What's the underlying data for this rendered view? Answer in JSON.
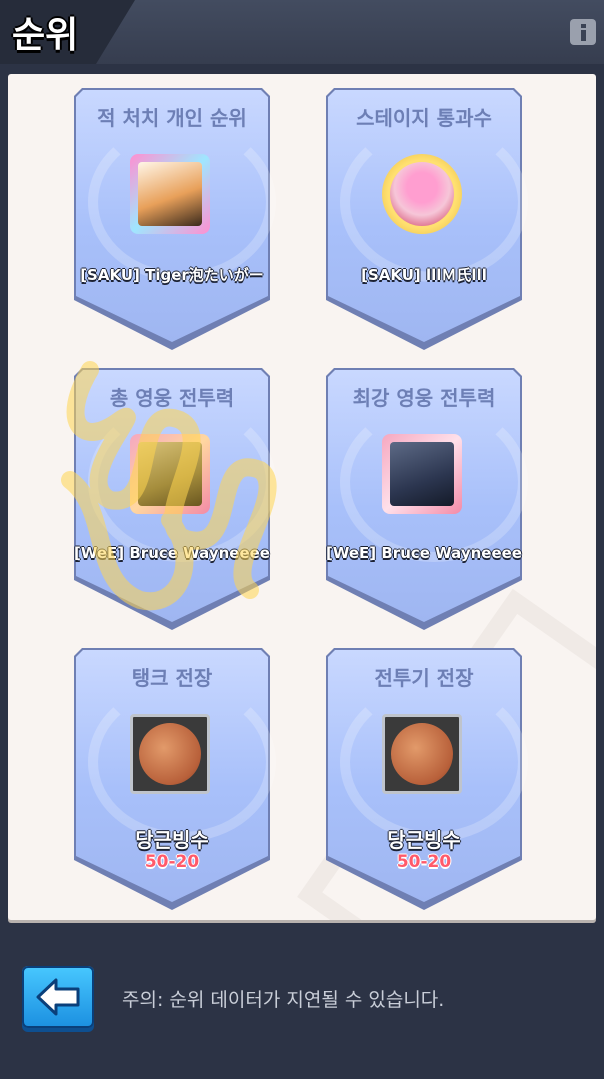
{
  "header": {
    "title": "순위",
    "info_icon": "info-icon"
  },
  "cards": [
    {
      "title": "적 처치 개인 순위",
      "player": "[SAKU] Tiger泡たいがー",
      "avatar": "tiger-avatar"
    },
    {
      "title": "스테이지 통과수",
      "player": "[SAKU] lllＭ氏lll",
      "avatar": "heart-character-avatar"
    },
    {
      "title": "총 영웅 전투력",
      "player": "[WeE] Bruce Wayneeee",
      "avatar": "car-avatar-gold"
    },
    {
      "title": "최강 영웅 전투력",
      "player": "[WeE] Bruce Wayneeee",
      "avatar": "car-avatar"
    },
    {
      "title": "탱크 전장",
      "player": "당근빙수",
      "stage": "50-20",
      "avatar": "moon-avatar"
    },
    {
      "title": "전투기 전장",
      "player": "당근빙수",
      "stage": "50-20",
      "avatar": "moon-avatar"
    }
  ],
  "footer": {
    "back_icon": "arrow-left-icon",
    "notice": "주의: 순위 데이터가 지연될 수 있습니다."
  },
  "colors": {
    "header_bg": "#3c4458",
    "panel_bg": "#f9f4f1",
    "card_blue": "#a8c0fa",
    "card_title": "#6d7fb5",
    "stage_red": "#ff5a6a",
    "back_button": "#1b8fe0"
  }
}
